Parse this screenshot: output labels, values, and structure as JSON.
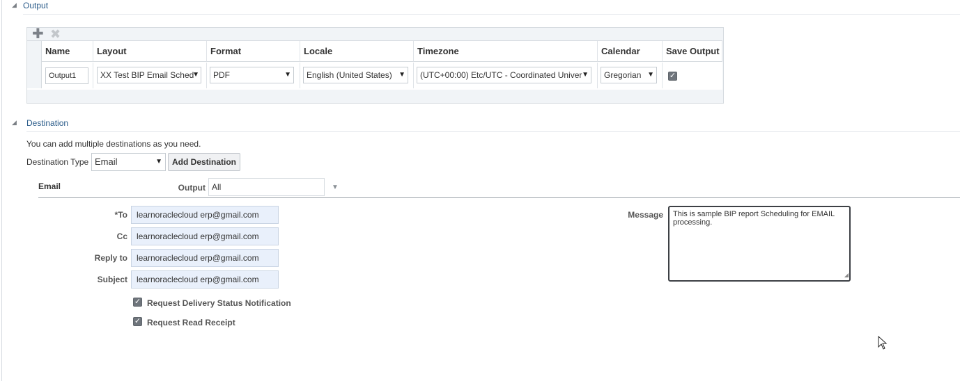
{
  "output_section": {
    "title": "Output",
    "toolbar": {
      "add_icon": "plus-icon",
      "remove_icon": "close-icon"
    },
    "columns": [
      "Name",
      "Layout",
      "Format",
      "Locale",
      "Timezone",
      "Calendar",
      "Save Output"
    ],
    "rows": [
      {
        "name": "Output1",
        "layout": "XX Test BIP Email Sched",
        "format": "PDF",
        "locale": "English (United States)",
        "timezone": "(UTC+00:00) Etc/UTC - Coordinated Univer",
        "calendar": "Gregorian",
        "save_output": true
      }
    ]
  },
  "destination_section": {
    "title": "Destination",
    "hint": "You can add multiple destinations as you need.",
    "destination_type_label": "Destination Type",
    "destination_type_value": "Email",
    "add_destination_label": "Add Destination",
    "email_heading": "Email",
    "output_label": "Output",
    "output_value": "All",
    "to_label": "*To",
    "to_value": "learnoraclecloud erp@gmail.com",
    "cc_label": "Cc",
    "cc_value": "learnoraclecloud erp@gmail.com",
    "reply_to_label": "Reply to",
    "reply_to_value": "learnoraclecloud erp@gmail.com",
    "subject_label": "Subject",
    "subject_value": "learnoraclecloud erp@gmail.com",
    "message_label": "Message",
    "message_value": "This is sample BIP report Scheduling for EMAIL processing.",
    "delivery_status_label": "Request Delivery Status Notification",
    "delivery_status_checked": true,
    "read_receipt_label": "Request Read Receipt",
    "read_receipt_checked": true
  }
}
